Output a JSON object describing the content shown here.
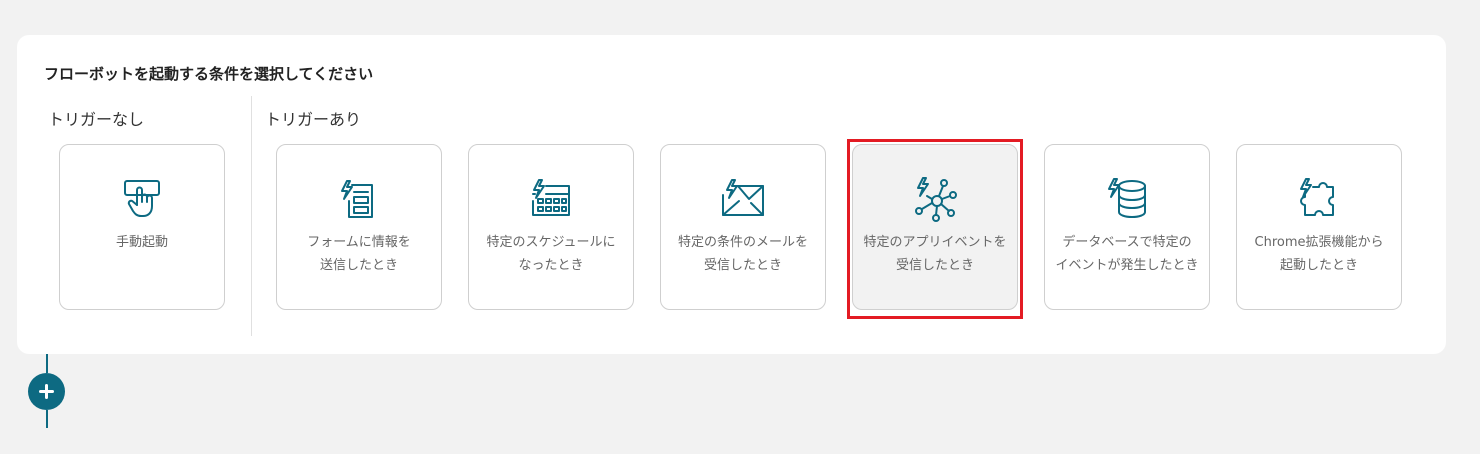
{
  "heading": "フローボットを起動する条件を選択してください",
  "sections": {
    "no_trigger": "トリガーなし",
    "with_trigger": "トリガーあり"
  },
  "cards": [
    {
      "label": "手動起動",
      "icon": "manual-tap-icon"
    },
    {
      "label": "フォームに情報を\n送信したとき",
      "icon": "form-trigger-icon"
    },
    {
      "label": "特定のスケジュールに\nなったとき",
      "icon": "calendar-trigger-icon"
    },
    {
      "label": "特定の条件のメールを\n受信したとき",
      "icon": "mail-trigger-icon"
    },
    {
      "label": "特定のアプリイベントを\n受信したとき",
      "icon": "app-event-trigger-icon"
    },
    {
      "label": "データベースで特定の\nイベントが発生したとき",
      "icon": "database-trigger-icon"
    },
    {
      "label": "Chrome拡張機能から\n起動したとき",
      "icon": "puzzle-trigger-icon"
    }
  ],
  "selected_card": "特定のアプリイベントを受信したとき",
  "add_step": {
    "icon": "plus-icon"
  },
  "colors": {
    "accent": "#0d6a82",
    "highlight": "#e31b23",
    "background": "#f2f2f2"
  }
}
